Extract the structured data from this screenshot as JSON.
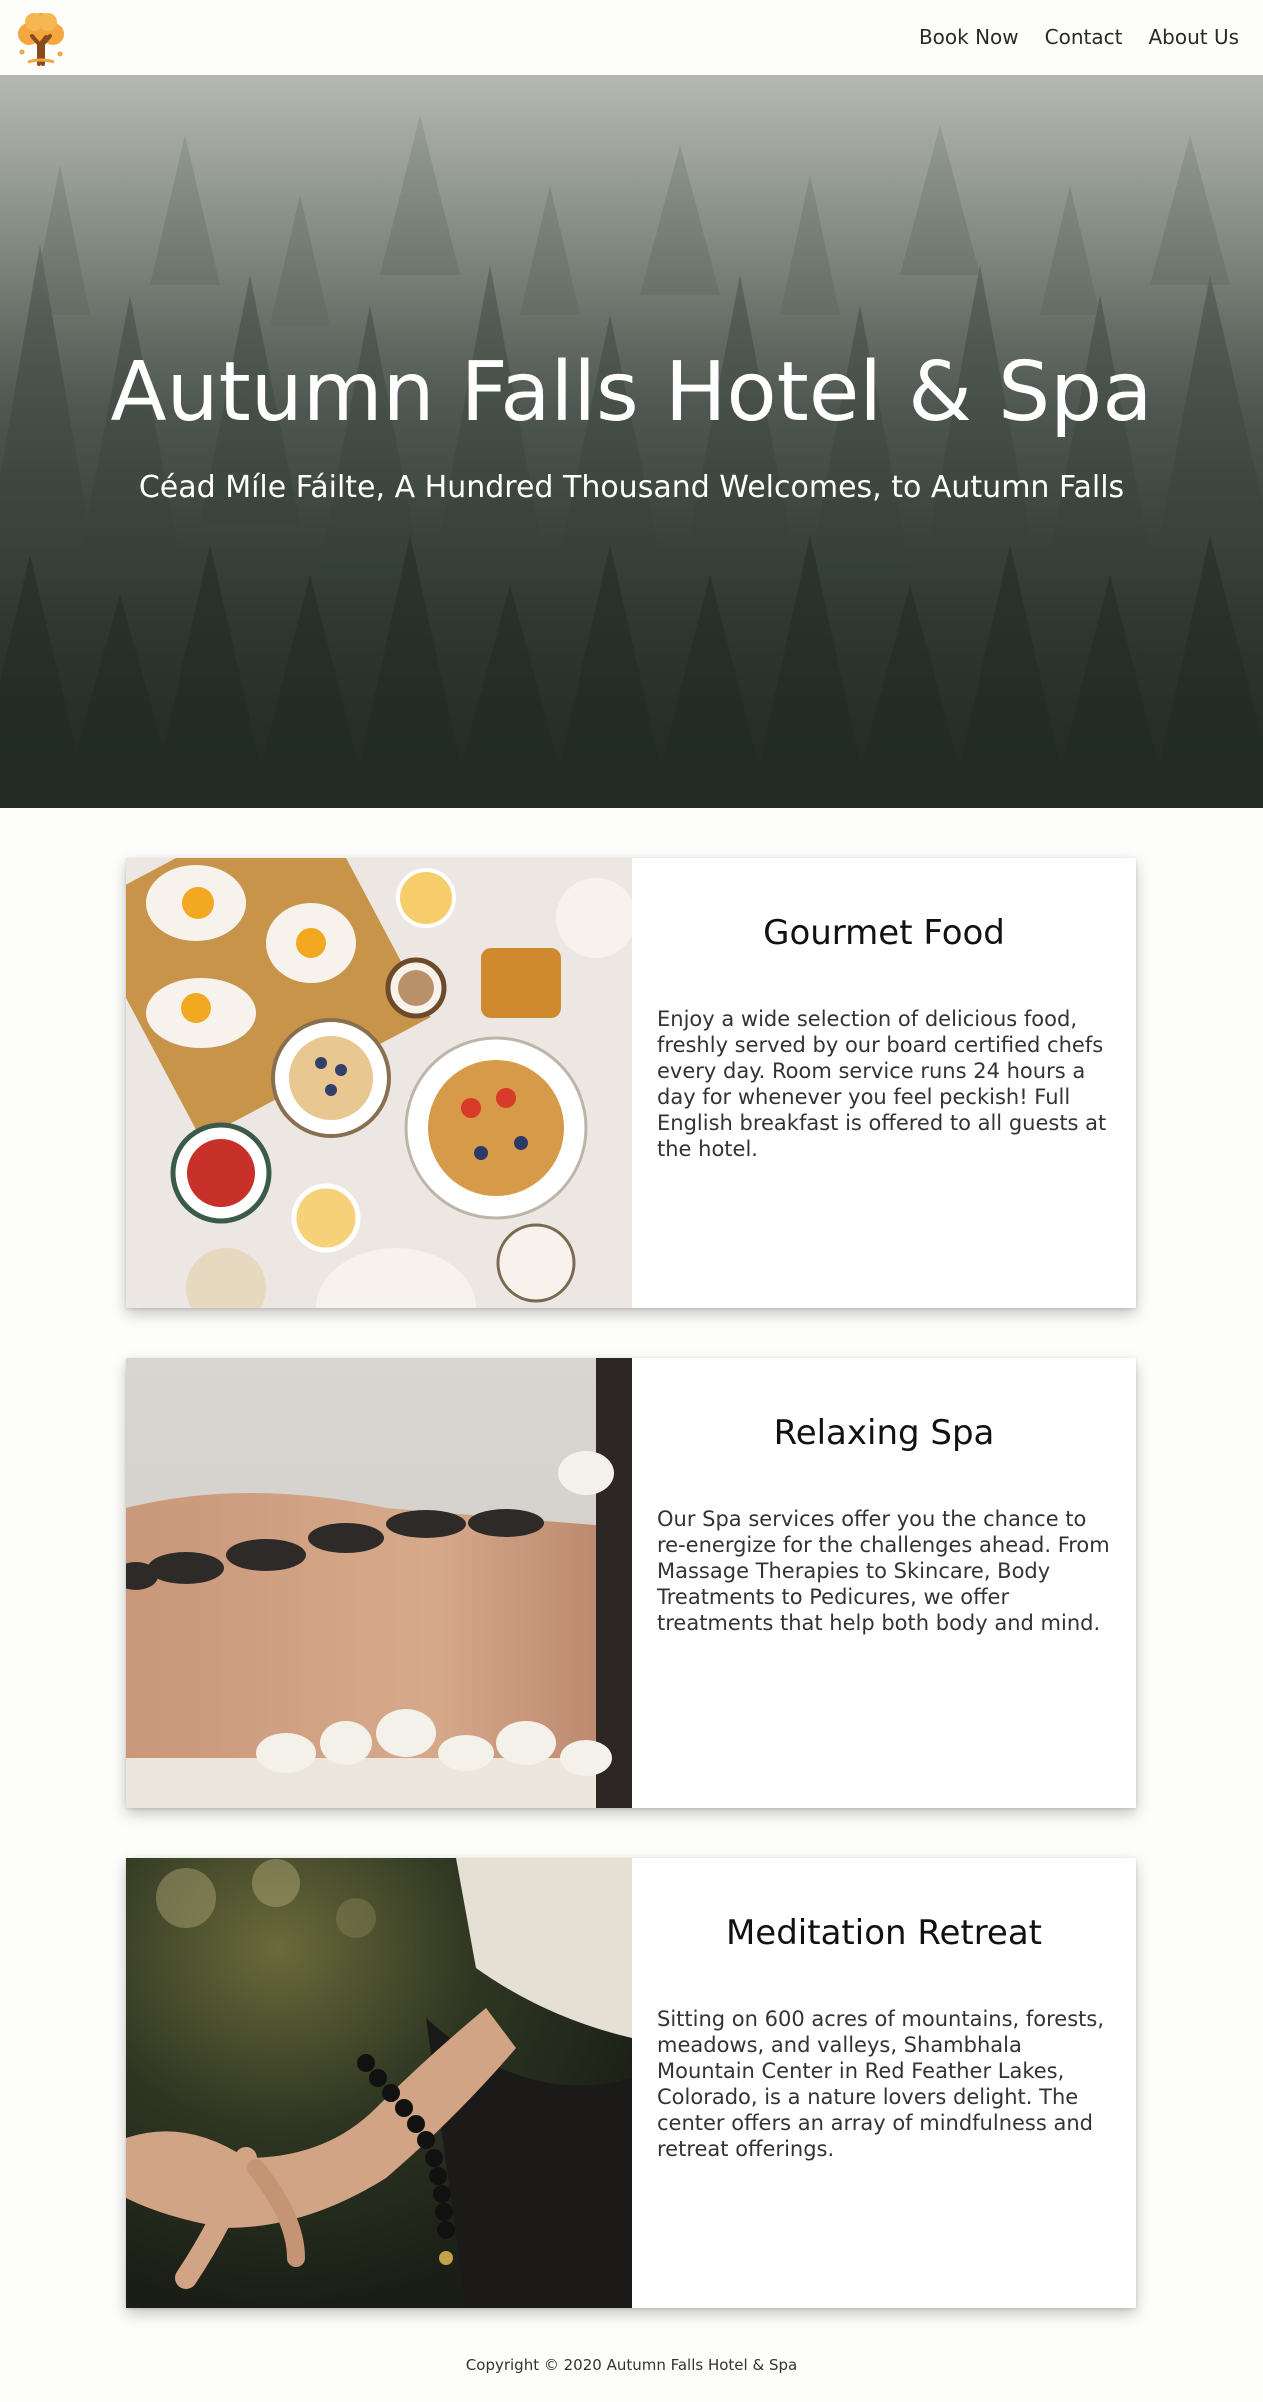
{
  "nav": {
    "items": [
      "Book Now",
      "Contact",
      "About Us"
    ]
  },
  "logo_icon": "autumn-tree-icon",
  "hero": {
    "title": "Autumn Falls Hotel & Spa",
    "subtitle": "Céad Míle Fáilte, A Hundred Thousand Welcomes, to Autumn Falls"
  },
  "cards": [
    {
      "title": "Gourmet Food",
      "text": "Enjoy a wide selection of delicious food, freshly served by our board certified chefs every day. Room service runs 24 hours a day for whenever you feel peckish! Full English breakfast is offered to all guests at the hotel."
    },
    {
      "title": "Relaxing Spa",
      "text": "Our Spa services offer you the chance to re-energize for the challenges ahead. From Massage Therapies to Skincare, Body Treatments to Pedicures, we offer treatments that help both body and mind."
    },
    {
      "title": "Meditation Retreat",
      "text": "Sitting on 600 acres of mountains, forests, meadows, and valleys, Shambhala Mountain Center in Red Feather Lakes, Colorado, is a nature lovers delight. The center offers an array of mindfulness and retreat offerings."
    }
  ],
  "footer": {
    "copyright": "Copyright © 2020 Autumn Falls Hotel & Spa"
  },
  "colors": {
    "logo_orange": "#f0a23a",
    "logo_trunk": "#8a4a1c",
    "page_bg": "#fdfdfb"
  }
}
